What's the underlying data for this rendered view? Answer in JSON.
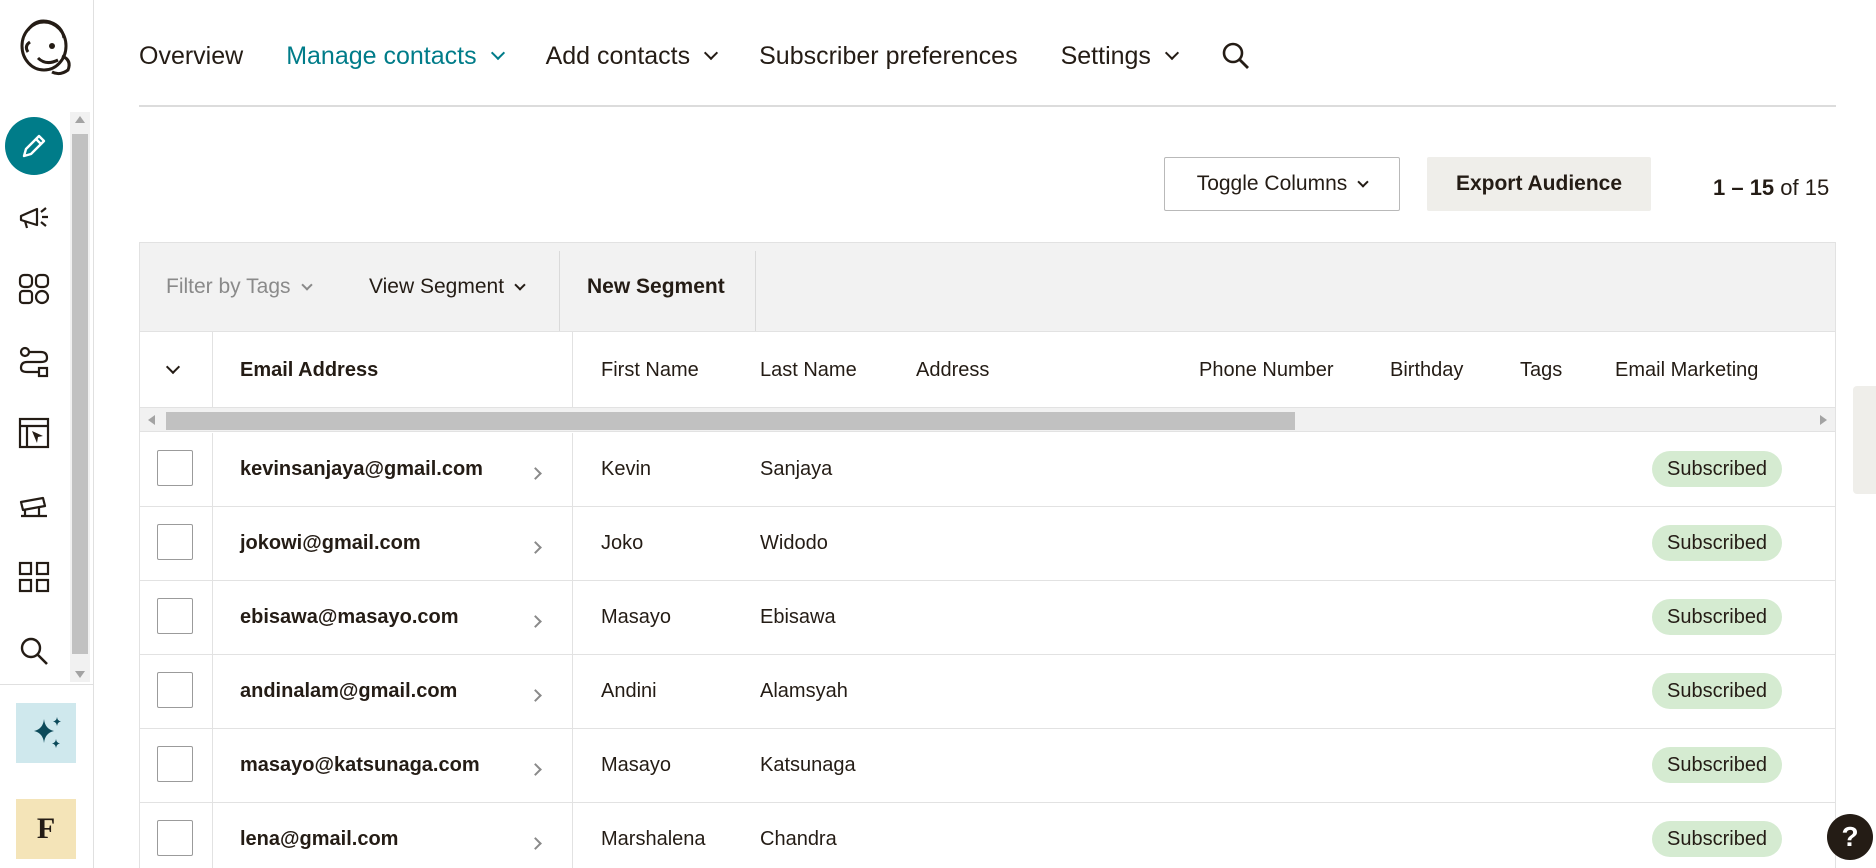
{
  "nav": {
    "overview": "Overview",
    "manage_contacts": "Manage contacts",
    "add_contacts": "Add contacts",
    "subscriber_preferences": "Subscriber preferences",
    "settings": "Settings"
  },
  "toolbar": {
    "toggle_columns": "Toggle Columns",
    "export_audience": "Export Audience",
    "pager_range": "1 – 15",
    "pager_of": "of",
    "pager_total": "15"
  },
  "filters": {
    "filter_by_tags": "Filter by Tags",
    "view_segment": "View Segment",
    "new_segment": "New Segment"
  },
  "table": {
    "columns": {
      "email": "Email Address",
      "first_name": "First Name",
      "last_name": "Last Name",
      "address": "Address",
      "phone": "Phone Number",
      "birthday": "Birthday",
      "tags": "Tags",
      "email_marketing": "Email Marketing"
    },
    "rows": [
      {
        "email": "kevinsanjaya@gmail.com",
        "first": "Kevin",
        "last": "Sanjaya",
        "status": "Subscribed"
      },
      {
        "email": "jokowi@gmail.com",
        "first": "Joko",
        "last": "Widodo",
        "status": "Subscribed"
      },
      {
        "email": "ebisawa@masayo.com",
        "first": "Masayo",
        "last": "Ebisawa",
        "status": "Subscribed"
      },
      {
        "email": "andinalam@gmail.com",
        "first": "Andini",
        "last": "Alamsyah",
        "status": "Subscribed"
      },
      {
        "email": "masayo@katsunaga.com",
        "first": "Masayo",
        "last": "Katsunaga",
        "status": "Subscribed"
      },
      {
        "email": "lena@gmail.com",
        "first": "Marshalena",
        "last": "Chandra",
        "status": "Subscribed"
      }
    ]
  },
  "account": {
    "initial": "F"
  },
  "help": {
    "label": "?"
  },
  "colors": {
    "accent": "#007c89",
    "badge_bg": "#d5ebd1",
    "export_bg": "#efeeea"
  },
  "icons": [
    "mailchimp-logo-icon",
    "pencil-icon",
    "megaphone-icon",
    "audience-icon",
    "automations-icon",
    "website-icon",
    "integrations-icon",
    "grid-icon",
    "search-icon",
    "sparkle-icon"
  ]
}
